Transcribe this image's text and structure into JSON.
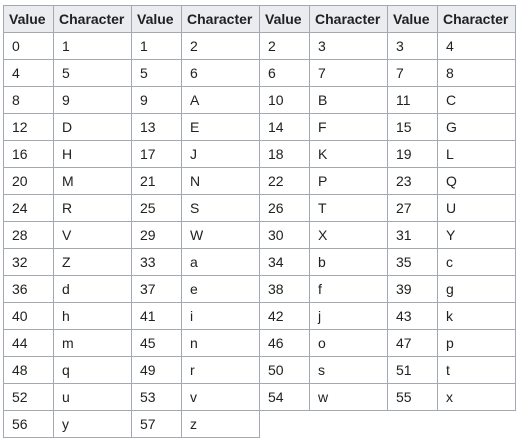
{
  "table": {
    "headers": [
      "Value",
      "Character",
      "Value",
      "Character",
      "Value",
      "Character",
      "Value",
      "Character"
    ],
    "rows": [
      [
        [
          "0",
          "1"
        ],
        [
          "1",
          "2"
        ],
        [
          "2",
          "3"
        ],
        [
          "3",
          "4"
        ]
      ],
      [
        [
          "4",
          "5"
        ],
        [
          "5",
          "6"
        ],
        [
          "6",
          "7"
        ],
        [
          "7",
          "8"
        ]
      ],
      [
        [
          "8",
          "9"
        ],
        [
          "9",
          "A"
        ],
        [
          "10",
          "B"
        ],
        [
          "11",
          "C"
        ]
      ],
      [
        [
          "12",
          "D"
        ],
        [
          "13",
          "E"
        ],
        [
          "14",
          "F"
        ],
        [
          "15",
          "G"
        ]
      ],
      [
        [
          "16",
          "H"
        ],
        [
          "17",
          "J"
        ],
        [
          "18",
          "K"
        ],
        [
          "19",
          "L"
        ]
      ],
      [
        [
          "20",
          "M"
        ],
        [
          "21",
          "N"
        ],
        [
          "22",
          "P"
        ],
        [
          "23",
          "Q"
        ]
      ],
      [
        [
          "24",
          "R"
        ],
        [
          "25",
          "S"
        ],
        [
          "26",
          "T"
        ],
        [
          "27",
          "U"
        ]
      ],
      [
        [
          "28",
          "V"
        ],
        [
          "29",
          "W"
        ],
        [
          "30",
          "X"
        ],
        [
          "31",
          "Y"
        ]
      ],
      [
        [
          "32",
          "Z"
        ],
        [
          "33",
          "a"
        ],
        [
          "34",
          "b"
        ],
        [
          "35",
          "c"
        ]
      ],
      [
        [
          "36",
          "d"
        ],
        [
          "37",
          "e"
        ],
        [
          "38",
          "f"
        ],
        [
          "39",
          "g"
        ]
      ],
      [
        [
          "40",
          "h"
        ],
        [
          "41",
          "i"
        ],
        [
          "42",
          "j"
        ],
        [
          "43",
          "k"
        ]
      ],
      [
        [
          "44",
          "m"
        ],
        [
          "45",
          "n"
        ],
        [
          "46",
          "o"
        ],
        [
          "47",
          "p"
        ]
      ],
      [
        [
          "48",
          "q"
        ],
        [
          "49",
          "r"
        ],
        [
          "50",
          "s"
        ],
        [
          "51",
          "t"
        ]
      ],
      [
        [
          "52",
          "u"
        ],
        [
          "53",
          "v"
        ],
        [
          "54",
          "w"
        ],
        [
          "55",
          "x"
        ]
      ],
      [
        [
          "56",
          "y"
        ],
        [
          "57",
          "z"
        ]
      ]
    ]
  },
  "colors": {
    "header_bg": "#eaecf0",
    "border": "#a2a9b1",
    "text": "#202122"
  }
}
